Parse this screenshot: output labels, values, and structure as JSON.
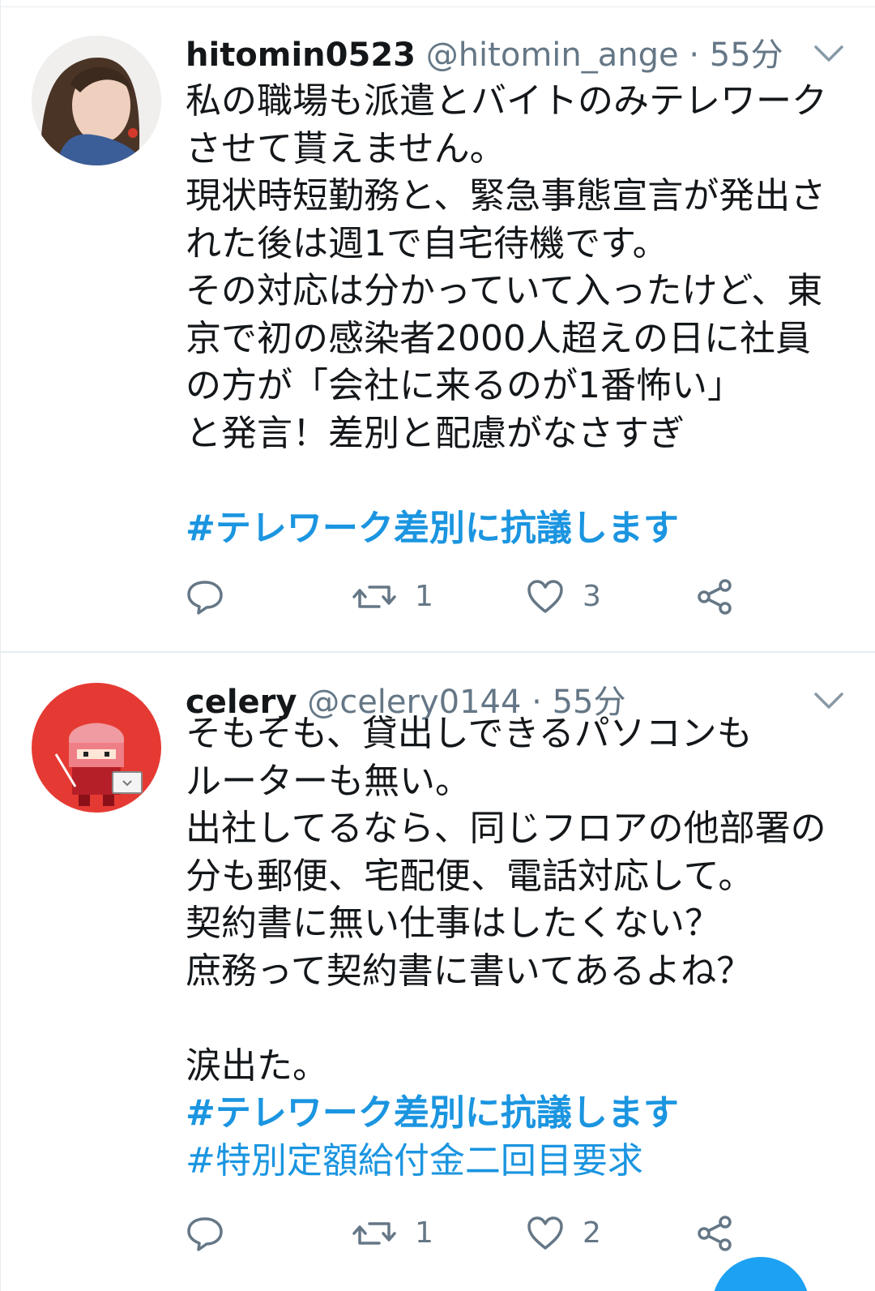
{
  "tweets": [
    {
      "display_name": "hitomin0523",
      "handle": "@hitomin_ange",
      "separator": "·",
      "time": "55分",
      "body_lines": [
        "私の職場も派遣とバイトのみテレワーク",
        "させて貰えません。",
        "現状時短勤務と、緊急事態宣言が発出さ",
        "れた後は週1で自宅待機です。",
        "その対応は分かっていて入ったけど、東",
        "京で初の感染者2000人超えの日に社員",
        "の方が「会社に来るのが1番怖い」",
        "と発言！差別と配慮がなさすぎ"
      ],
      "hashtags": [
        "#テレワーク差別に抗議します"
      ],
      "retweets": "1",
      "likes": "3"
    },
    {
      "display_name": "celery",
      "handle": "@celery0144",
      "separator": "·",
      "time": "55分",
      "body_lines": [
        "そもそも、貸出しできるパソコンも",
        "ルーターも無い。",
        "出社してるなら、同じフロアの他部署の",
        "分も郵便、宅配便、電話対応して。",
        "契約書に無い仕事はしたくない？",
        "庶務って契約書に書いてあるよね？"
      ],
      "body_after_blank": "涙出た。",
      "hashtags": [
        "#テレワーク差別に抗議します",
        "#特別定額給付金二回目要求"
      ],
      "retweets": "1",
      "likes": "2"
    }
  ],
  "icons": {
    "reply": "reply-icon",
    "retweet": "retweet-icon",
    "like": "heart-icon",
    "share": "share-icon",
    "menu": "chevron-down-icon"
  },
  "colors": {
    "text": "#14171a",
    "secondary": "#657786",
    "link": "#1b95e0",
    "divider": "#e6ecf0",
    "accent": "#1da1f2"
  }
}
